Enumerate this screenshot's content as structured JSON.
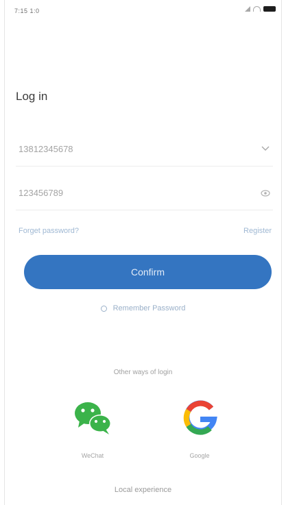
{
  "status_bar": {
    "time": "7:15 1:0",
    "icons": [
      "signal-icon",
      "wifi-icon",
      "battery-icon"
    ]
  },
  "title": "Log in",
  "phone_field": {
    "value": "13812345678",
    "icon": "chevron-down-icon"
  },
  "password_field": {
    "value": "123456789",
    "icon": "eye-icon"
  },
  "links": {
    "forgot": "Forget password?",
    "signup": "Register"
  },
  "confirm_label": "Confirm",
  "remember_label": "Remember Password",
  "other_login_label": "Other ways of login",
  "social": {
    "wechat": {
      "label": "WeChat",
      "icon": "wechat-icon"
    },
    "google": {
      "label": "Google",
      "icon": "google-icon"
    }
  },
  "local_experience": "Local experience",
  "colors": {
    "accent": "#3475c1",
    "link": "#9fb8d3",
    "wechat": "#3bb34a"
  }
}
